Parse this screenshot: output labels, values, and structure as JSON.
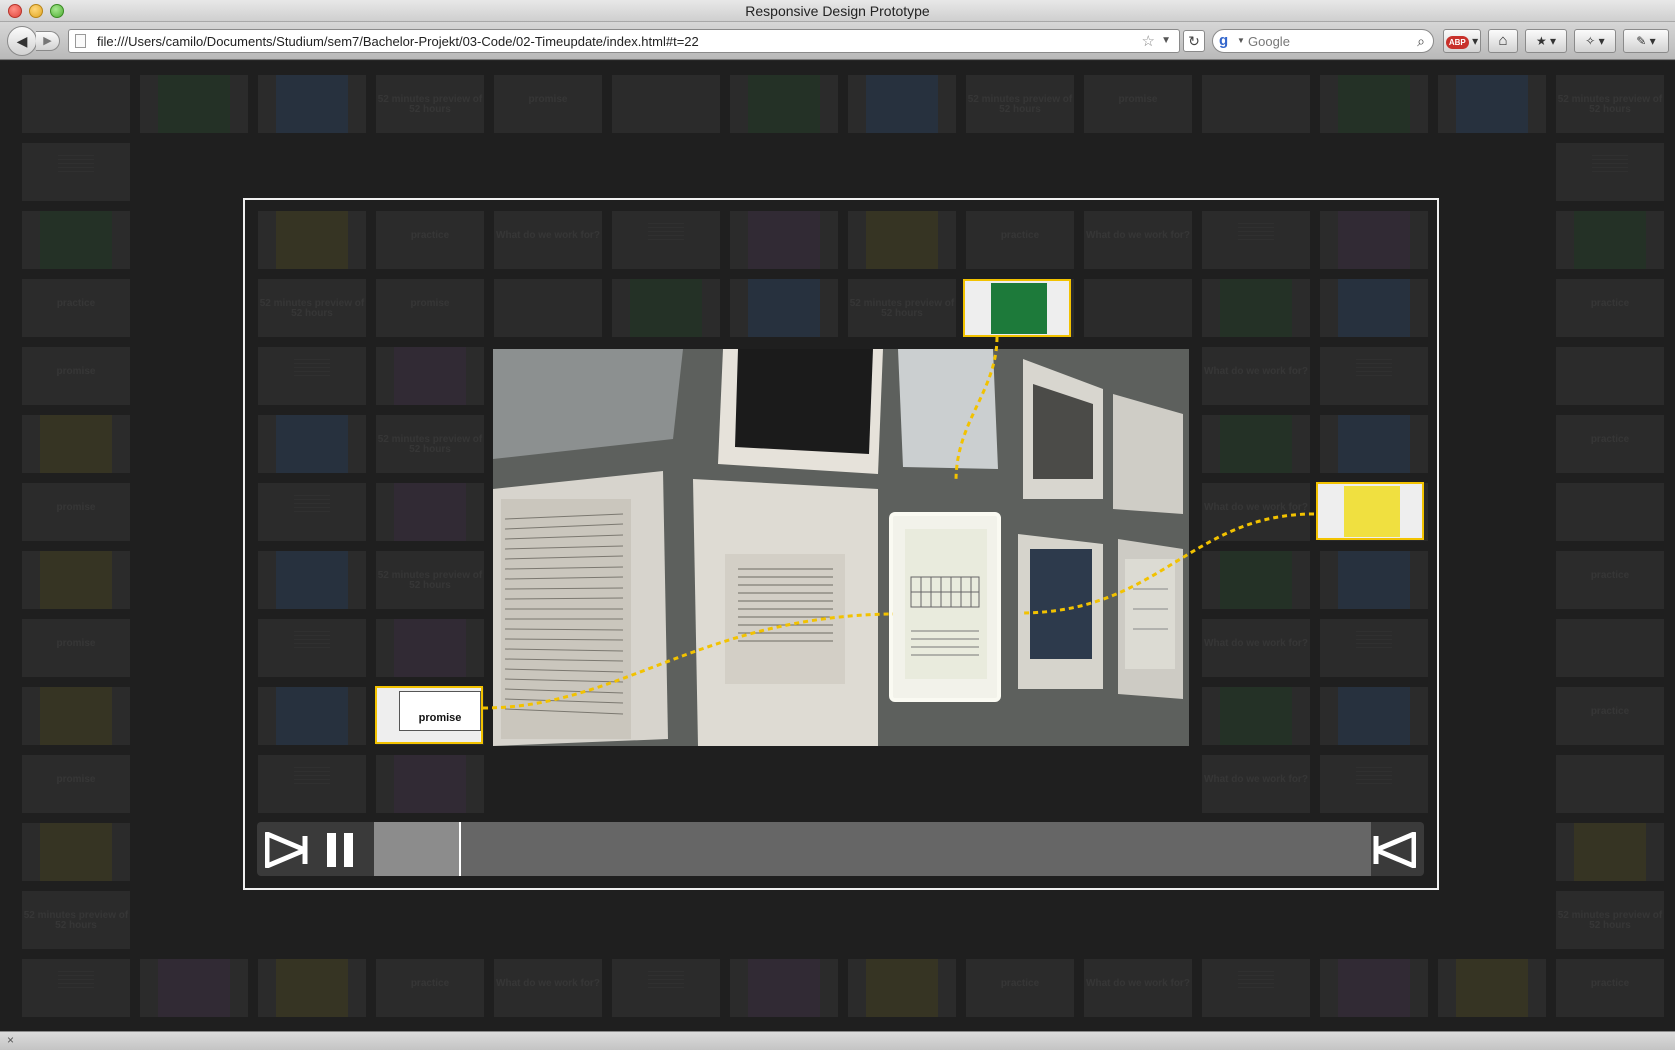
{
  "window": {
    "title": "Responsive Design Prototype"
  },
  "toolbar": {
    "url": "file:///Users/camilo/Documents/Studium/sem7/Bachelor-Projekt/03-Code/02-Timeupdate/index.html#t=22",
    "search_placeholder": "Google",
    "adblock_label": "ABP"
  },
  "accent_color": "#f2c200",
  "labels": {
    "promise": "promise",
    "work": "What do we work for?",
    "preview": "52 minutes preview of 52 hours",
    "practice": "practice"
  },
  "highlight": {
    "left_label": "promise"
  },
  "player": {
    "progress": 0.085,
    "state": "playing"
  },
  "icons": {
    "prev": "scissors-prev-icon",
    "pause": "pause-icon",
    "next": "scissors-next-icon"
  }
}
